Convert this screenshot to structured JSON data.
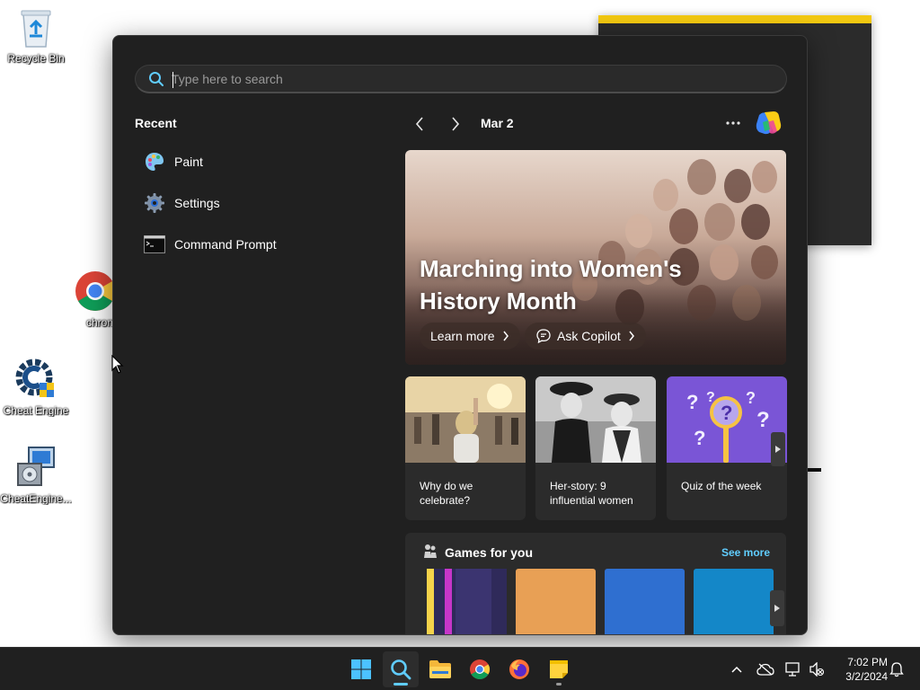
{
  "desktop": {
    "icons": [
      {
        "label": "Recycle Bin"
      },
      {
        "label": "chrome"
      },
      {
        "label": "Cheat Engine"
      },
      {
        "label": "CheatEngine..."
      }
    ]
  },
  "search": {
    "placeholder": "Type here to search"
  },
  "recent": {
    "title": "Recent",
    "items": [
      {
        "label": "Paint",
        "icon": "paint-icon"
      },
      {
        "label": "Settings",
        "icon": "gear-icon"
      },
      {
        "label": "Command Prompt",
        "icon": "terminal-icon"
      }
    ]
  },
  "highlights": {
    "date": "Mar 2",
    "hero": {
      "title": "Marching into Women's History Month",
      "learn_more": "Learn more",
      "ask_copilot": "Ask Copilot"
    },
    "cards": [
      {
        "text": "Why do we celebrate?"
      },
      {
        "text": "Her-story: 9 influential women"
      },
      {
        "text": "Quiz of the week"
      }
    ],
    "games": {
      "title": "Games for you",
      "see_more": "See more",
      "tile_colors": [
        "#2f2a5a",
        "#e8a055",
        "#2f6fd0",
        "#1487c8"
      ]
    }
  },
  "taskbar": {
    "clock_time": "7:02 PM",
    "clock_date": "3/2/2024"
  },
  "colors": {
    "accent": "#60cdff",
    "panel": "#202020",
    "card": "#2b2b2b"
  }
}
